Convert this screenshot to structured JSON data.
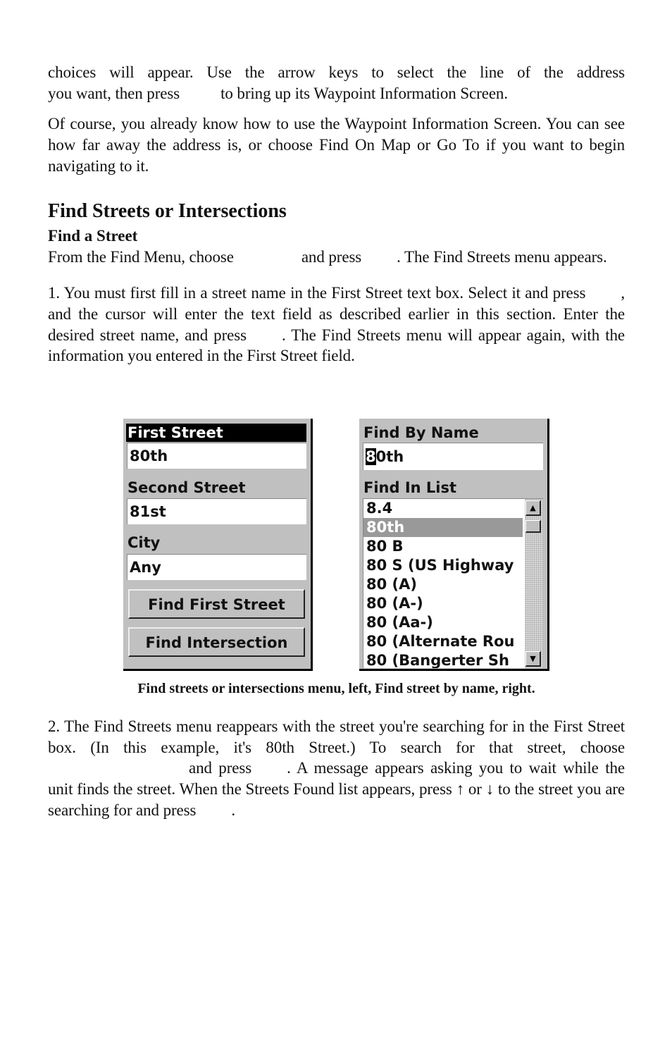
{
  "paragraphs": {
    "p1_line1": "choices will appear. Use the arrow keys to select the line of the address",
    "p1_line2a": "you want, then press",
    "p1_line2b": "to bring up its Waypoint Information Screen.",
    "p2": "Of course, you already know how to use the Waypoint Information Screen. You can see how far away the address is, or choose Find On Map or Go To if you want to begin navigating to it."
  },
  "section": {
    "heading": "Find Streets or Intersections",
    "subheading": "Find a Street",
    "intro_a": "From the Find Menu, choose",
    "intro_b": "and press",
    "intro_c": ". The Find Streets menu appears."
  },
  "step1": {
    "a": "1. You must first fill in a street name in the First Street text box. Select it and press",
    "b": ", and the cursor will enter the text field as described earlier in this section. Enter the desired street name, and press",
    "c": ". The Find Streets menu will appear again, with the information you en­tered in the First Street field."
  },
  "left_screen": {
    "first_street_label": "First Street",
    "first_street_value": "80th",
    "second_street_label": "Second Street",
    "second_street_value": "81st",
    "city_label": "City",
    "city_value": "Any",
    "find_first_street_button": "Find First Street",
    "find_intersection_button": "Find Intersection"
  },
  "right_screen": {
    "find_by_name_label": "Find By Name",
    "find_by_name_cursor_char": "8",
    "find_by_name_rest": "0th",
    "find_in_list_label": "Find In List",
    "list_items": [
      "8.4",
      "80th",
      "80  B",
      "80  S (US Highway",
      "80 (A)",
      "80 (A-)",
      "80 (Aa-)",
      "80 (Alternate Rou",
      "80 (Bangerter Sh"
    ],
    "selected_index": 1,
    "scroll_up_icon": "▲",
    "scroll_down_icon": "▼"
  },
  "caption": "Find streets or intersections menu, left, Find street by name, right.",
  "step2": {
    "a": "2. The Find Streets menu reappears with the street you're searching for in the First Street box. (In this example, it's 80th Street.) To search for that street, choose",
    "b": "and press",
    "c": ". A message appears asking you to wait while the unit finds the street. When the Streets Found list appears, press ↑ or ↓ to the street you are searching for and press",
    "d": "."
  }
}
